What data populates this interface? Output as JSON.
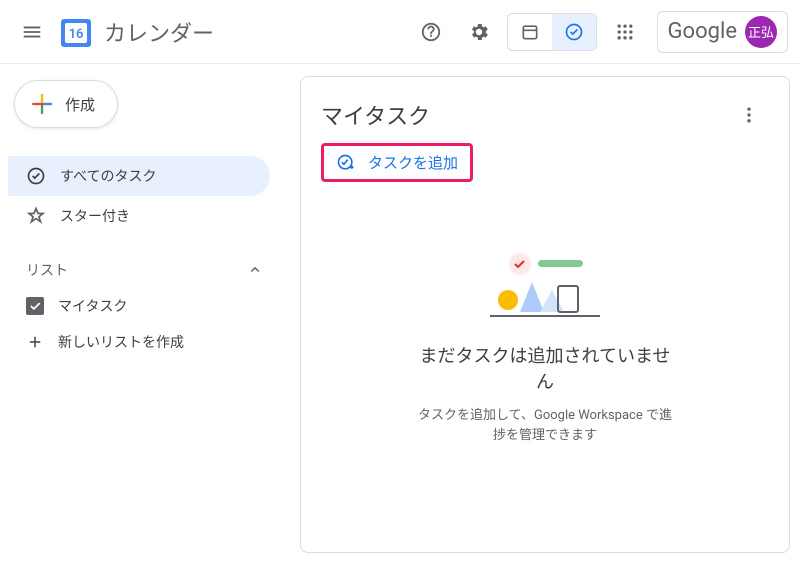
{
  "header": {
    "app_title": "カレンダー",
    "logo_day": "16",
    "google_label": "Google",
    "avatar_initials": "正弘"
  },
  "sidebar": {
    "create_label": "作成",
    "nav": [
      {
        "label": "すべてのタスク",
        "active": true
      },
      {
        "label": "スター付き",
        "active": false
      }
    ],
    "list_section_label": "リスト",
    "lists": [
      {
        "label": "マイタスク",
        "checked": true
      }
    ],
    "new_list_label": "新しいリストを作成"
  },
  "main": {
    "card_title": "マイタスク",
    "add_task_label": "タスクを追加",
    "empty_title": "まだタスクは追加されていません",
    "empty_sub": "タスクを追加して、Google Workspace で進捗を管理できます"
  }
}
